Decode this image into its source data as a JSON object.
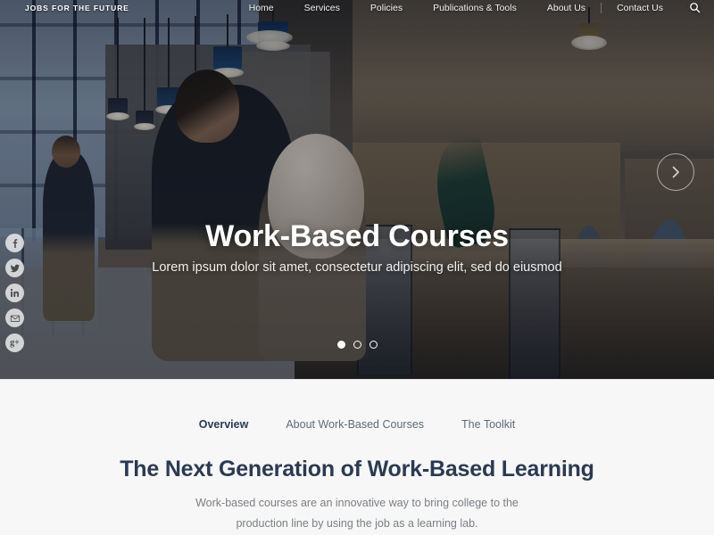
{
  "site": {
    "logo_text": "JOBS FOR THE FUTURE"
  },
  "nav": {
    "items": [
      {
        "label": "Home",
        "name": "nav-item-home"
      },
      {
        "label": "Services",
        "name": "nav-item-services"
      },
      {
        "label": "Policies",
        "name": "nav-item-policies"
      },
      {
        "label": "Publications & Tools",
        "name": "nav-item-publications-tools"
      },
      {
        "label": "About Us",
        "name": "nav-item-about-us"
      },
      {
        "label": "Contact Us",
        "name": "nav-item-contact-us"
      }
    ],
    "search_icon": "search-icon"
  },
  "social": {
    "items": [
      {
        "label": "f",
        "name": "facebook-icon"
      },
      {
        "label": "t",
        "name": "twitter-icon"
      },
      {
        "label": "in",
        "name": "linkedin-icon"
      },
      {
        "label": "m",
        "name": "email-icon"
      },
      {
        "label": "g+",
        "name": "google-plus-icon"
      }
    ]
  },
  "hero": {
    "title": "Work-Based Courses",
    "subtitle": "Lorem ipsum dolor sit amet, consectetur adipiscing elit, sed do eiusmod",
    "slides": [
      {
        "active": true
      },
      {
        "active": false
      },
      {
        "active": false
      }
    ],
    "next_label": "next-slide",
    "overlay_color": "#0a0e18"
  },
  "section": {
    "tabs": [
      {
        "label": "Overview",
        "active": true
      },
      {
        "label": "About Work-Based Courses",
        "active": false
      },
      {
        "label": "The Toolkit",
        "active": false
      }
    ],
    "title": "The Next Generation of Work-Based Learning",
    "body_line_1": "Work-based courses are an innovative way to bring college to the",
    "body_line_2": "production line by using the job as a learning lab.",
    "accent_color": "#2b3a52",
    "background_color": "#f7f7f7"
  }
}
